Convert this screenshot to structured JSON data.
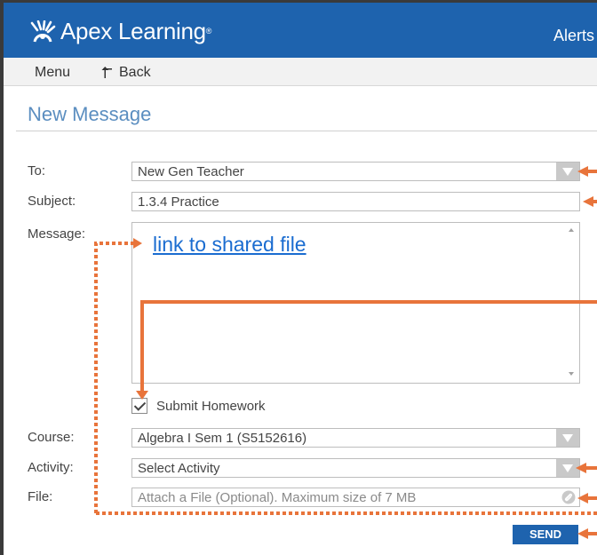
{
  "header": {
    "brand": "Apex Learning",
    "trademark": "®",
    "alerts": "Alerts"
  },
  "nav": {
    "menu": "Menu",
    "back": "Back"
  },
  "page": {
    "title": "New Message"
  },
  "form": {
    "to": {
      "label": "To:",
      "value": "New Gen Teacher"
    },
    "subject": {
      "label": "Subject:",
      "value": "1.3.4 Practice"
    },
    "message": {
      "label": "Message:",
      "link_text": "link to shared file"
    },
    "submit_homework": {
      "label": "Submit Homework",
      "checked": true
    },
    "course": {
      "label": "Course:",
      "value": "Algebra I Sem 1 (S5152616)"
    },
    "activity": {
      "label": "Activity:",
      "value": "Select Activity"
    },
    "file": {
      "label": "File:",
      "placeholder": "Attach a File (Optional). Maximum size of 7 MB"
    },
    "send": "SEND"
  },
  "colors": {
    "header_blue": "#1e63ae",
    "title_blue": "#5b8ec0",
    "annotation_orange": "#e8743b",
    "link_blue": "#1a6cd0"
  },
  "icons": {
    "logo": "apex-logo-icon",
    "back": "back-arrow-icon",
    "dropdown": "triangle-down-icon",
    "attach": "paperclip-icon",
    "check": "checkmark-icon"
  }
}
